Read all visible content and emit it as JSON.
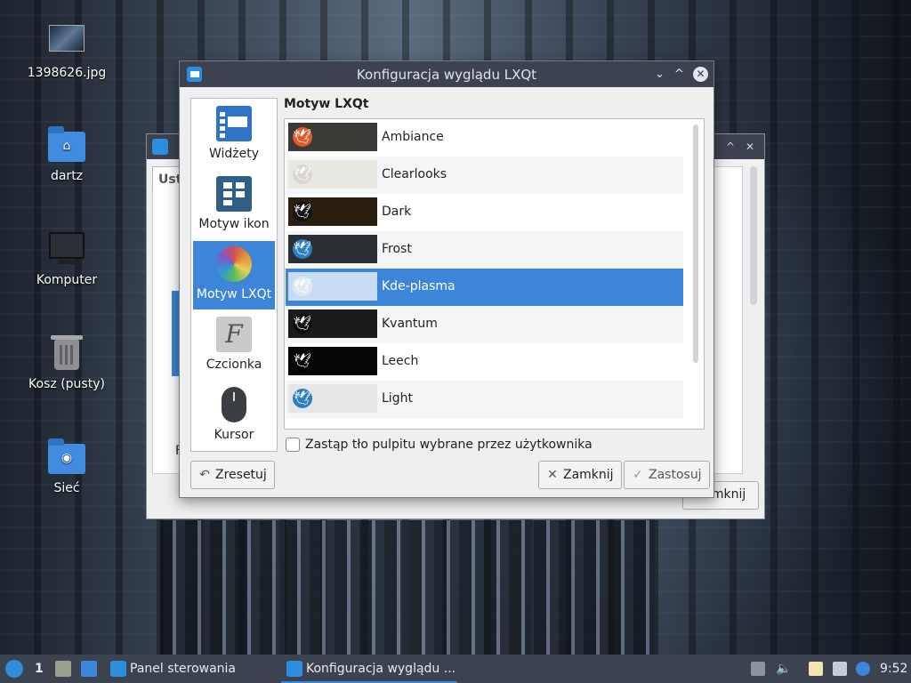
{
  "desktop": {
    "icons": [
      {
        "label": "1398626.jpg",
        "icon": "image-file-icon"
      },
      {
        "label": "dartz",
        "icon": "home-folder-icon"
      },
      {
        "label": "Komputer",
        "icon": "computer-icon"
      },
      {
        "label": "Kosz (pusty)",
        "icon": "trash-icon"
      },
      {
        "label": "Sieć",
        "icon": "network-folder-icon"
      }
    ]
  },
  "background_window": {
    "tab_label": "Ust",
    "close_label": "Zamknij",
    "partial_text": "F"
  },
  "dialog": {
    "title": "Konfiguracja wyglądu LXQt",
    "sidebar": [
      {
        "label": "Widżety",
        "icon": "widgets-icon",
        "selected": false
      },
      {
        "label": "Motyw ikon",
        "icon": "icon-theme-icon",
        "selected": false
      },
      {
        "label": "Motyw LXQt",
        "icon": "lxqt-theme-icon",
        "selected": true
      },
      {
        "label": "Czcionka",
        "icon": "font-icon",
        "selected": false
      },
      {
        "label": "Kursor",
        "icon": "mouse-cursor-icon",
        "selected": false
      }
    ],
    "section_title": "Motyw LXQt",
    "themes": [
      {
        "name": "Ambiance",
        "selected": false,
        "preview_bg": "#3b3a36",
        "badge": "#e05a2a"
      },
      {
        "name": "Clearlooks",
        "selected": false,
        "preview_bg": "#e9e7e2",
        "badge": "#d9d6cf"
      },
      {
        "name": "Dark",
        "selected": false,
        "preview_bg": "#2a1f10",
        "badge": "#111111"
      },
      {
        "name": "Frost",
        "selected": false,
        "preview_bg": "#2b2e33",
        "badge": "#2d7fbf"
      },
      {
        "name": "Kde-plasma",
        "selected": true,
        "preview_bg": "#c8ddf3",
        "badge": "#dfe9f5"
      },
      {
        "name": "Kvantum",
        "selected": false,
        "preview_bg": "#1b1b1b",
        "badge": "#0d0d0d"
      },
      {
        "name": "Leech",
        "selected": false,
        "preview_bg": "#050505",
        "badge": "#000000"
      },
      {
        "name": "Light",
        "selected": false,
        "preview_bg": "#e6e6e6",
        "badge": "#2d7fbf"
      }
    ],
    "checkbox_label": "Zastąp tło pulpitu wybrane przez użytkownika",
    "checkbox_checked": false,
    "buttons": {
      "reset": "Zresetuj",
      "close": "Zamknij",
      "apply": "Zastosuj"
    }
  },
  "taskbar": {
    "desktop_number": "1",
    "tasks": [
      {
        "label": "Panel sterowania",
        "active": false
      },
      {
        "label": "Konfiguracja wyglądu ...",
        "active": true
      }
    ],
    "clock": "9:52"
  },
  "colors": {
    "accent": "#3d85d8",
    "titlebar": "#3c4250",
    "dialog_bg": "#efefef"
  }
}
